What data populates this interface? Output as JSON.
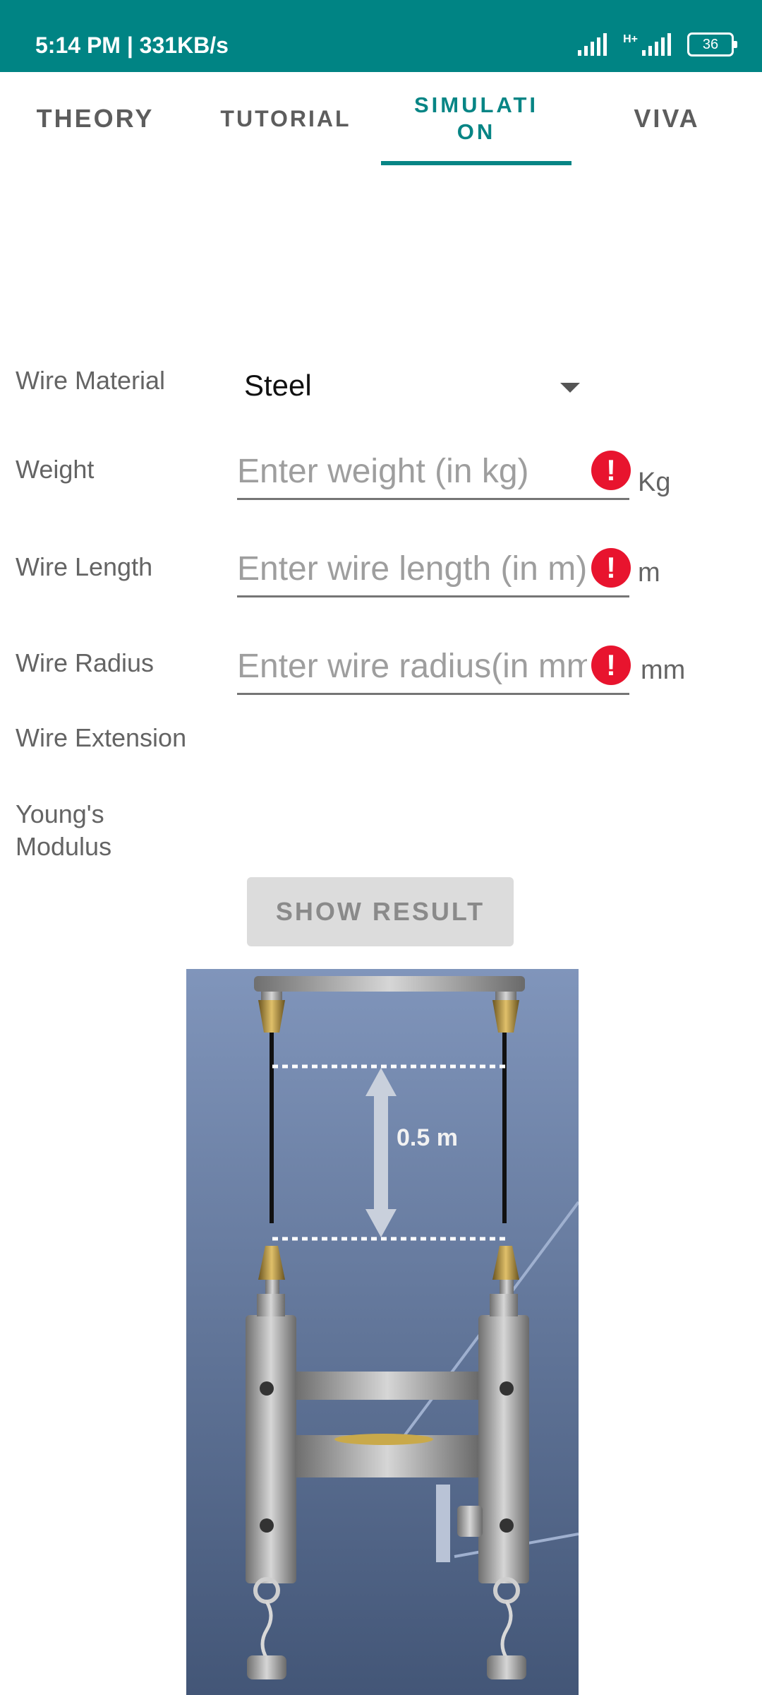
{
  "status_bar": {
    "time_speed": "5:14 PM | 331KB/s",
    "battery": "36",
    "network": "H+"
  },
  "tabs": [
    {
      "label": "THEORY"
    },
    {
      "label": "TUTORIAL"
    },
    {
      "label": "SIMULATION"
    },
    {
      "label": "VIVA"
    }
  ],
  "form": {
    "wire_material": {
      "label": "Wire Material",
      "value": "Steel"
    },
    "weight": {
      "label": "Weight",
      "placeholder": "Enter weight (in kg)",
      "unit": "Kg"
    },
    "wire_length": {
      "label": "Wire Length",
      "placeholder": "Enter wire length (in m)",
      "unit": "m"
    },
    "wire_radius": {
      "label": "Wire Radius",
      "placeholder": "Enter wire radius(in mm)",
      "unit": "mm"
    },
    "wire_extension": {
      "label": "Wire Extension"
    },
    "youngs_modulus": {
      "label": "Young's Modulus"
    }
  },
  "show_result_button": "SHOW RESULT",
  "simulation": {
    "length_label": "0.5 m",
    "colors": {
      "bg_top": "#8095bb",
      "bg_bottom": "#435677"
    }
  },
  "colors": {
    "accent": "#078585",
    "status_bar": "#008484",
    "error": "#e8142e"
  }
}
